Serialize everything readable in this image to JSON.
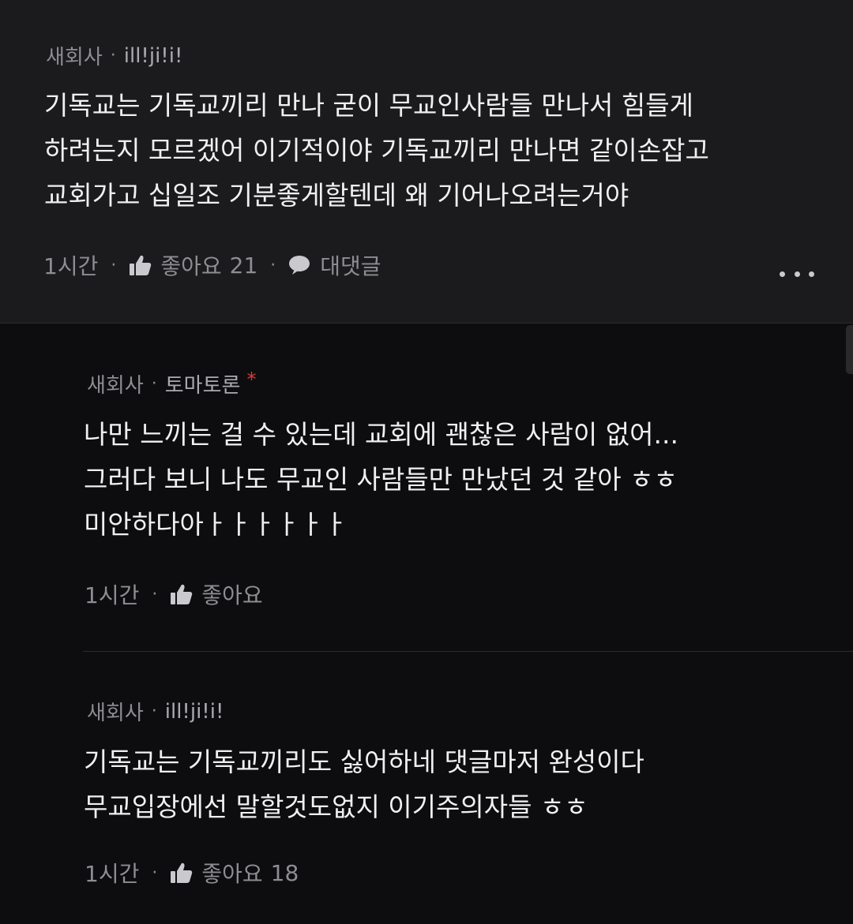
{
  "comments": [
    {
      "category": "새회사",
      "nickname": "ill!ji!i!",
      "lines": [
        "기독교는 기독교끼리 만나 굳이 무교인사람들 만나서 힘들게",
        "하려는지 모르겠어 이기적이야 기독교끼리 만나면 같이손잡고",
        "교회가고 십일조 기분좋게할텐데 왜 기어나오려는거야"
      ],
      "time": "1시간",
      "like_label": "좋아요",
      "like_count": "21",
      "reply_label": "대댓글"
    }
  ],
  "replies": [
    {
      "category": "새회사",
      "nickname": "토마토론",
      "author_mark": "*",
      "lines": [
        "나만 느끼는 걸 수 있는데 교회에 괜찮은 사람이 없어...",
        "그러다 보니 나도 무교인 사람들만 만났던 것 같아 ㅎㅎ",
        "미안하다아ㅏㅏㅏㅏㅏㅏ"
      ],
      "time": "1시간",
      "like_label": "좋아요",
      "like_count": ""
    },
    {
      "category": "새회사",
      "nickname": "ill!ji!i!",
      "lines": [
        "기독교는 기독교끼리도 싫어하네 댓글마저 완성이다",
        "무교입장에선 말할것도없지 이기주의자들 ㅎㅎ"
      ],
      "time": "1시간",
      "like_label": "좋아요",
      "like_count": "18"
    }
  ],
  "icons": {
    "like": "thumbs-up-icon",
    "reply": "speech-bubble-icon",
    "more": "more-horizontal-icon"
  },
  "colors": {
    "background": "#0c0c0e",
    "top_comment_bg": "#1b1b1d",
    "text": "#f0f0f2",
    "meta": "#8d8d92",
    "mark": "#e03a3a"
  }
}
